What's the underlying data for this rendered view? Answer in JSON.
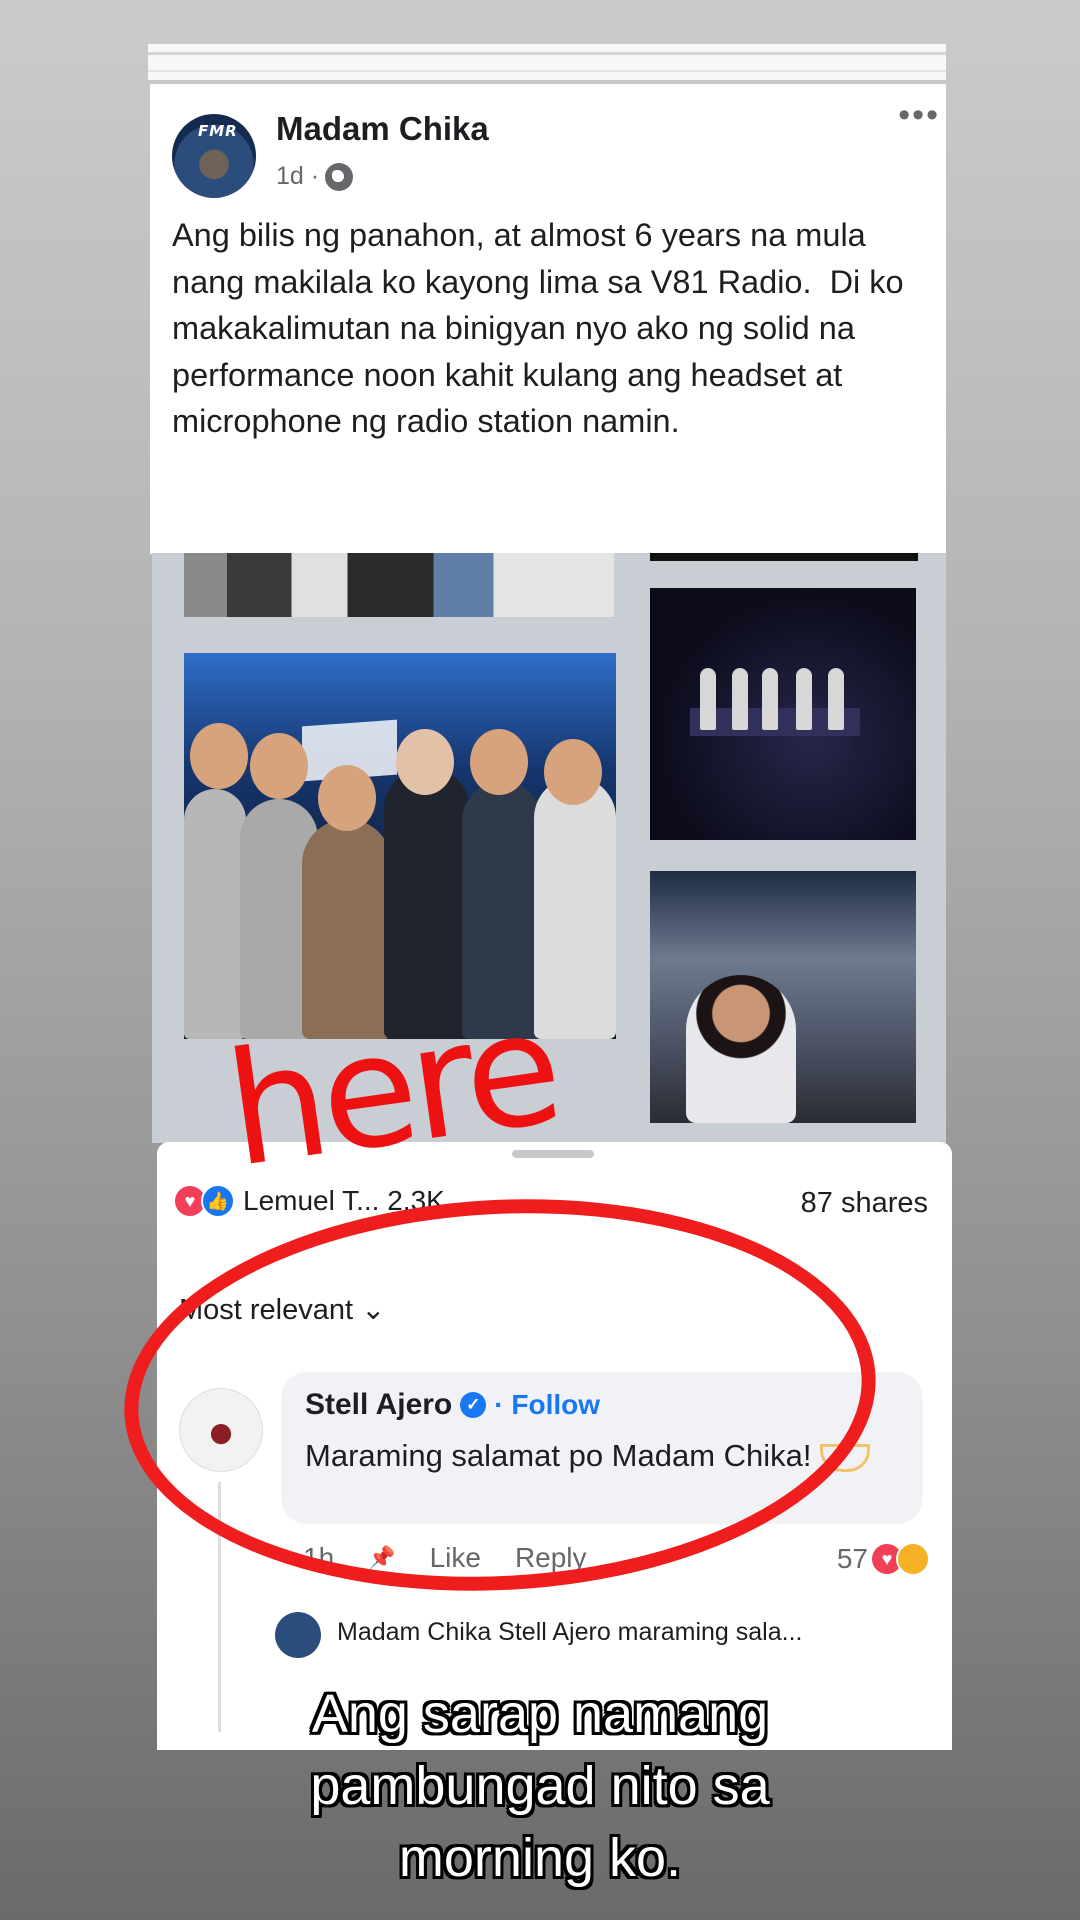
{
  "post": {
    "author": "Madam Chika",
    "time": "1d ·",
    "avatar_text": "FMR",
    "text": "Ang bilis ng panahon, at almost 6 years na mula nang makilala ko kayong lima sa V81 Radio.  Di ko makakalimutan na binigyan nyo ako ng solid na performance noon kahit kulang ang headset at microphone ng radio station namin."
  },
  "reactions": {
    "names": "Lemuel T... 2.3K",
    "shares": "87 shares",
    "sort": "Most relevant ⌄"
  },
  "comment": {
    "name": "Stell Ajero",
    "follow": "· Follow",
    "text": "Maraming salamat po Madam Chika!",
    "time": "1h",
    "like": "Like",
    "reply": "Reply",
    "count": "57"
  },
  "reply_preview": "Madam Chika Stell Ajero maraming sala...",
  "annotation": "here",
  "caption": [
    "Ang sarap namang",
    "pambungad nito sa",
    "morning ko."
  ],
  "colors": {
    "accent": "#1877f2",
    "annotation": "#ef1d1d"
  }
}
